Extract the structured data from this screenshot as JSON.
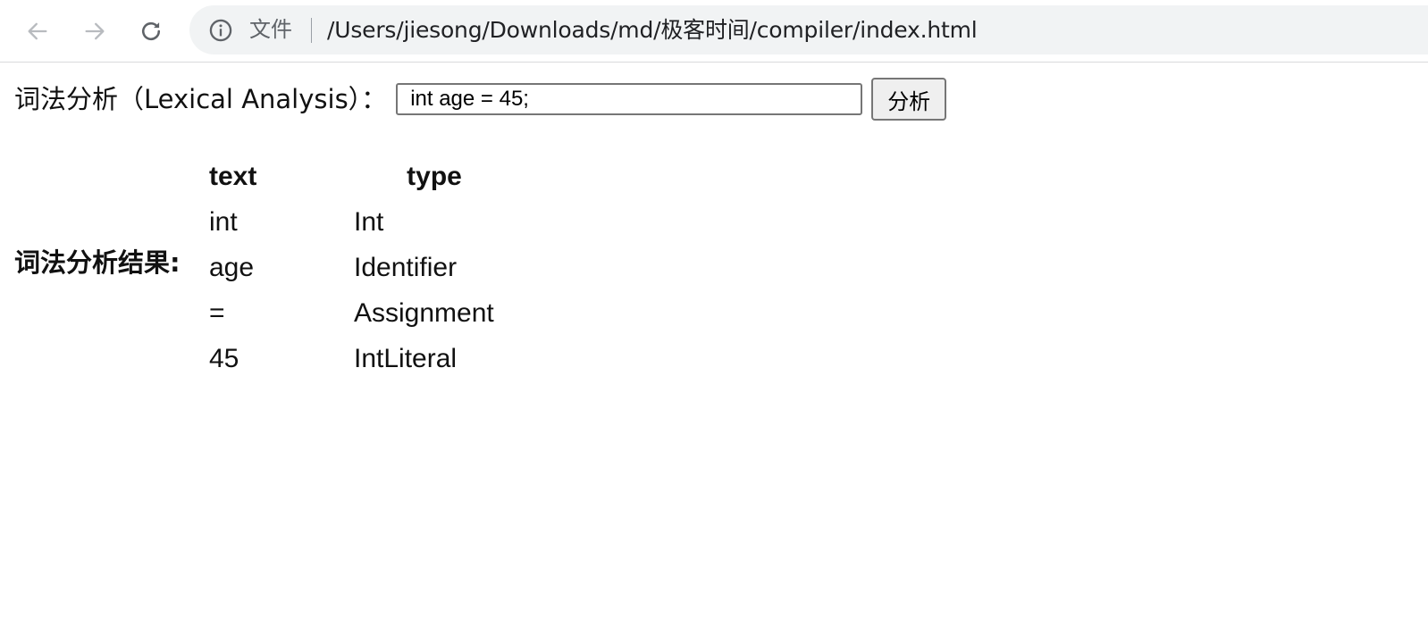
{
  "browser": {
    "scheme_label": "文件",
    "url": "/Users/jiesong/Downloads/md/极客时间/compiler/index.html",
    "icons": {
      "back": "arrow-left-icon",
      "forward": "arrow-right-icon",
      "reload": "reload-icon",
      "info": "info-circle-icon"
    }
  },
  "page": {
    "input_label": "词法分析（Lexical Analysis）：",
    "input_value": "int age = 45;",
    "analyze_button": "分析",
    "result_label": "词法分析结果:",
    "table": {
      "headers": [
        "text",
        "type"
      ],
      "rows": [
        {
          "text": "int",
          "type": "Int"
        },
        {
          "text": "age",
          "type": "Identifier"
        },
        {
          "text": "=",
          "type": "Assignment"
        },
        {
          "text": "45",
          "type": "IntLiteral"
        }
      ]
    }
  }
}
